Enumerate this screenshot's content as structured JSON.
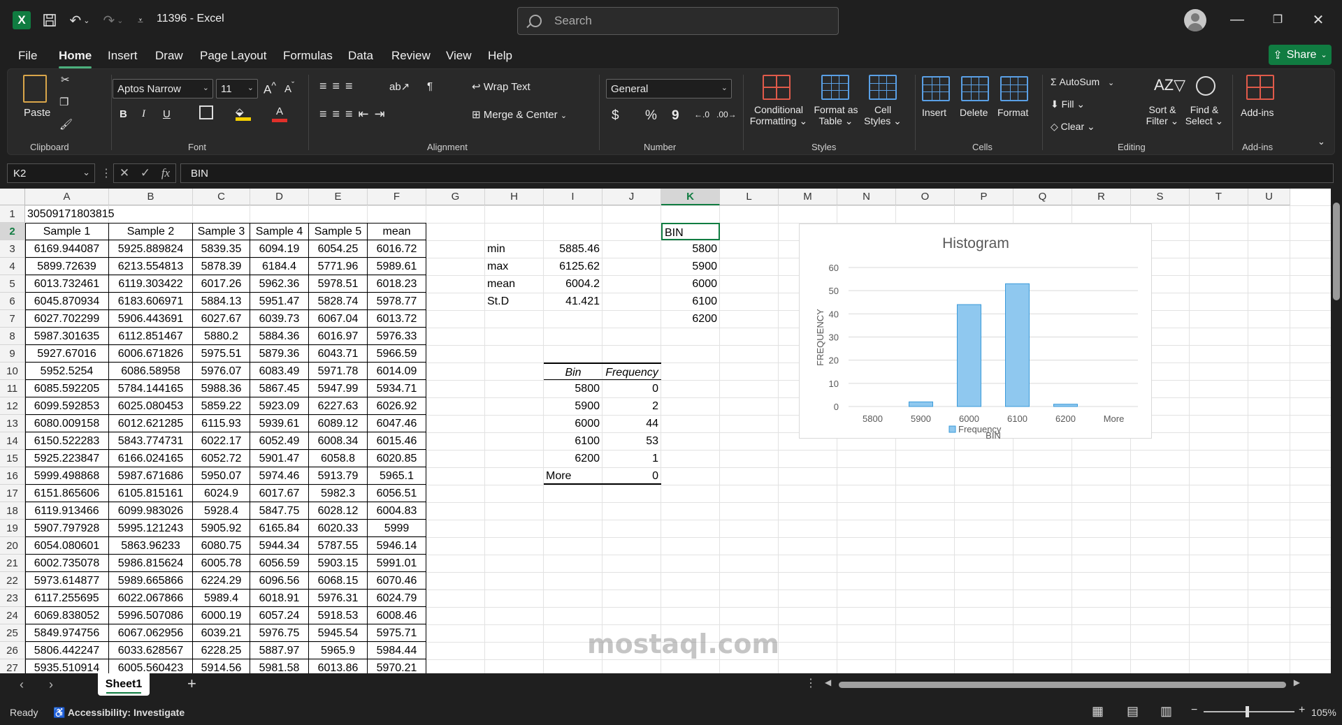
{
  "app": {
    "doc_title": "11396  -  Excel",
    "search_placeholder": "Search"
  },
  "menu": [
    "File",
    "Home",
    "Insert",
    "Draw",
    "Page Layout",
    "Formulas",
    "Data",
    "Review",
    "View",
    "Help"
  ],
  "share_label": "Share",
  "ribbon": {
    "clipboard": {
      "paste": "Paste",
      "label": "Clipboard"
    },
    "font": {
      "name": "Aptos Narrow",
      "size": "11",
      "label": "Font",
      "bold": "B",
      "italic": "I",
      "underline": "U"
    },
    "alignment": {
      "wrap": "Wrap Text",
      "merge": "Merge & Center",
      "label": "Alignment"
    },
    "number": {
      "format": "General",
      "currency": "$",
      "percent": "%",
      "comma": "9",
      "label": "Number"
    },
    "styles": {
      "cond": "Conditional",
      "cond2": "Formatting",
      "fmt_table": "Format as",
      "fmt_table2": "Table",
      "cell": "Cell",
      "cell2": "Styles",
      "label": "Styles"
    },
    "cells": {
      "insert": "Insert",
      "delete": "Delete",
      "format": "Format",
      "label": "Cells"
    },
    "editing": {
      "autosum": "AutoSum",
      "fill": "Fill",
      "clear": "Clear",
      "sort": "Sort &",
      "sort2": "Filter",
      "find": "Find &",
      "find2": "Select",
      "label": "Editing"
    },
    "addins": {
      "addins": "Add-ins",
      "label": "Add-ins"
    }
  },
  "formula_bar": {
    "cell_ref": "K2",
    "fx": "fx",
    "content": "BIN"
  },
  "columns": [
    "A",
    "B",
    "C",
    "D",
    "E",
    "F",
    "G",
    "H",
    "I",
    "J",
    "K",
    "L",
    "M",
    "N",
    "O",
    "P",
    "Q",
    "R",
    "S",
    "T",
    "U"
  ],
  "rows": [
    "1",
    "2",
    "3",
    "4",
    "5",
    "6",
    "7",
    "8",
    "9",
    "10",
    "11",
    "12",
    "13",
    "14",
    "15",
    "16",
    "17",
    "18",
    "19",
    "20",
    "21",
    "22",
    "23",
    "24",
    "25",
    "26",
    "27"
  ],
  "a1": "30509171803815",
  "headers": [
    "Sample 1",
    "Sample 2",
    "Sample 3",
    "Sample 4",
    "Sample 5",
    "mean"
  ],
  "data": [
    [
      "6169.944087",
      "5925.889824",
      "5839.35",
      "6094.19",
      "6054.25",
      "6016.72"
    ],
    [
      "5899.72639",
      "6213.554813",
      "5878.39",
      "6184.4",
      "5771.96",
      "5989.61"
    ],
    [
      "6013.732461",
      "6119.303422",
      "6017.26",
      "5962.36",
      "5978.51",
      "6018.23"
    ],
    [
      "6045.870934",
      "6183.606971",
      "5884.13",
      "5951.47",
      "5828.74",
      "5978.77"
    ],
    [
      "6027.702299",
      "5906.443691",
      "6027.67",
      "6039.73",
      "6067.04",
      "6013.72"
    ],
    [
      "5987.301635",
      "6112.851467",
      "5880.2",
      "5884.36",
      "6016.97",
      "5976.33"
    ],
    [
      "5927.67016",
      "6006.671826",
      "5975.51",
      "5879.36",
      "6043.71",
      "5966.59"
    ],
    [
      "5952.5254",
      "6086.58958",
      "5976.07",
      "6083.49",
      "5971.78",
      "6014.09"
    ],
    [
      "6085.592205",
      "5784.144165",
      "5988.36",
      "5867.45",
      "5947.99",
      "5934.71"
    ],
    [
      "6099.592853",
      "6025.080453",
      "5859.22",
      "5923.09",
      "6227.63",
      "6026.92"
    ],
    [
      "6080.009158",
      "6012.621285",
      "6115.93",
      "5939.61",
      "6089.12",
      "6047.46"
    ],
    [
      "6150.522283",
      "5843.774731",
      "6022.17",
      "6052.49",
      "6008.34",
      "6015.46"
    ],
    [
      "5925.223847",
      "6166.024165",
      "6052.72",
      "5901.47",
      "6058.8",
      "6020.85"
    ],
    [
      "5999.498868",
      "5987.671686",
      "5950.07",
      "5974.46",
      "5913.79",
      "5965.1"
    ],
    [
      "6151.865606",
      "6105.815161",
      "6024.9",
      "6017.67",
      "5982.3",
      "6056.51"
    ],
    [
      "6119.913466",
      "6099.983026",
      "5928.4",
      "5847.75",
      "6028.12",
      "6004.83"
    ],
    [
      "5907.797928",
      "5995.121243",
      "5905.92",
      "6165.84",
      "6020.33",
      "5999"
    ],
    [
      "6054.080601",
      "5863.96233",
      "6080.75",
      "5944.34",
      "5787.55",
      "5946.14"
    ],
    [
      "6002.735078",
      "5986.815624",
      "6005.78",
      "6056.59",
      "5903.15",
      "5991.01"
    ],
    [
      "5973.614877",
      "5989.665866",
      "6224.29",
      "6096.56",
      "6068.15",
      "6070.46"
    ],
    [
      "6117.255695",
      "6022.067866",
      "5989.4",
      "6018.91",
      "5976.31",
      "6024.79"
    ],
    [
      "6069.838052",
      "5996.507086",
      "6000.19",
      "6057.24",
      "5918.53",
      "6008.46"
    ],
    [
      "5849.974756",
      "6067.062956",
      "6039.21",
      "5976.75",
      "5945.54",
      "5975.71"
    ],
    [
      "5806.442247",
      "6033.628567",
      "6228.25",
      "5887.97",
      "5965.9",
      "5984.44"
    ],
    [
      "5935.510914",
      "6005.560423",
      "5914.56",
      "5981.58",
      "6013.86",
      "5970.21"
    ]
  ],
  "stats": [
    {
      "label": "min",
      "value": "5885.46"
    },
    {
      "label": "max",
      "value": "6125.62"
    },
    {
      "label": "mean",
      "value": "6004.2"
    },
    {
      "label": "St.D",
      "value": "41.421"
    }
  ],
  "bin_header": "BIN",
  "bins": [
    "5800",
    "5900",
    "6000",
    "6100",
    "6200"
  ],
  "freq_table": {
    "headers": [
      "Bin",
      "Frequency"
    ],
    "rows": [
      [
        "5800",
        "0"
      ],
      [
        "5900",
        "2"
      ],
      [
        "6000",
        "44"
      ],
      [
        "6100",
        "53"
      ],
      [
        "6200",
        "1"
      ],
      [
        "More",
        "0"
      ]
    ]
  },
  "chart_data": {
    "type": "bar",
    "title": "Histogram",
    "xlabel": "BIN",
    "ylabel": "FREQUENCY",
    "categories": [
      "5800",
      "5900",
      "6000",
      "6100",
      "6200",
      "More"
    ],
    "series": [
      {
        "name": "Frequency",
        "values": [
          0,
          2,
          44,
          53,
          1,
          0
        ],
        "color": "#8fc8ef"
      }
    ],
    "ylim": [
      0,
      60
    ],
    "yticks": [
      "0",
      "10",
      "20",
      "30",
      "40",
      "50",
      "60"
    ],
    "legend": "bottom",
    "grid": true
  },
  "sheet_tab": "Sheet1",
  "status": {
    "ready": "Ready",
    "accessibility": "Accessibility: Investigate",
    "zoom": "105%"
  },
  "watermark": "mostaql.com"
}
